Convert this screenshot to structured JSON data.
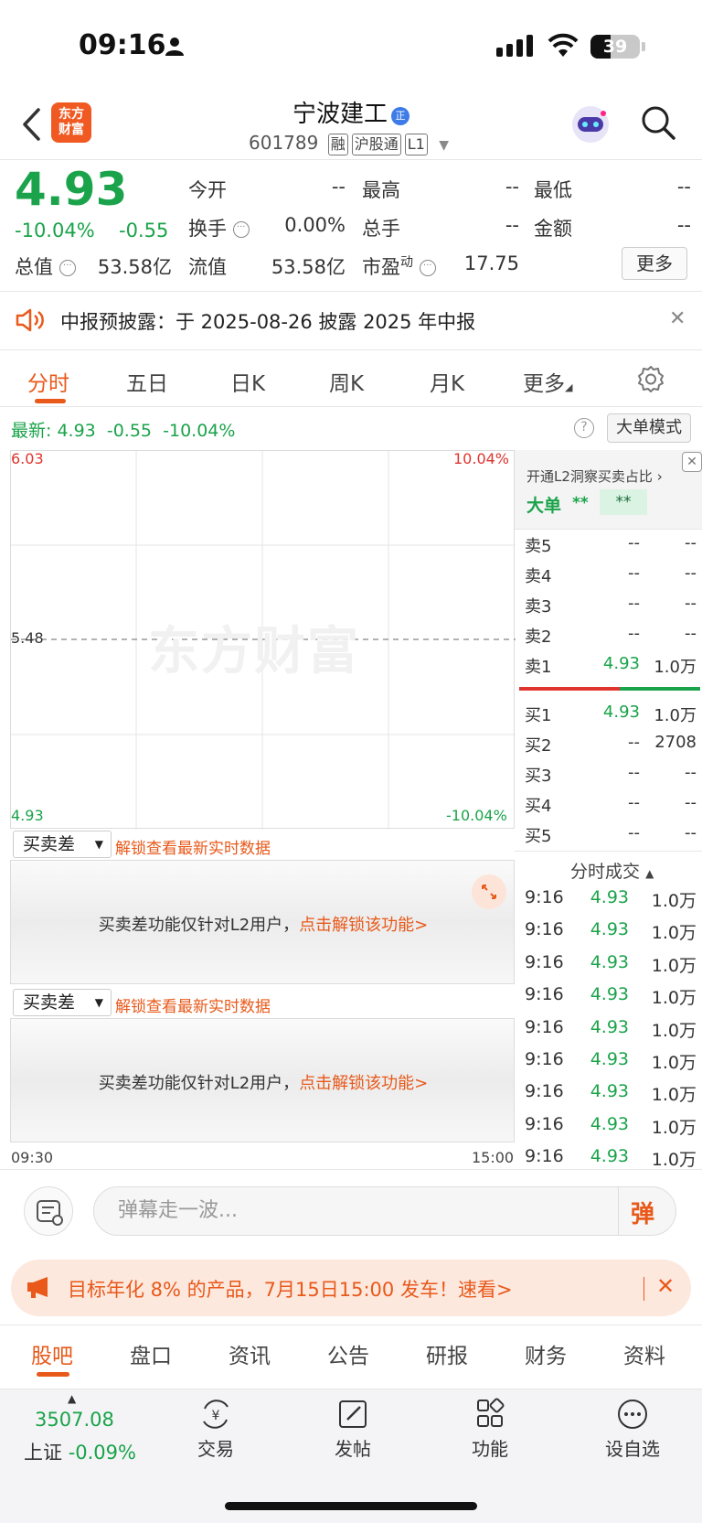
{
  "status": {
    "time": "09:16",
    "battery": "39"
  },
  "header": {
    "logo_line1": "东方",
    "logo_line2": "财富",
    "name": "宁波建工",
    "name_badge": "正",
    "code": "601789",
    "tags": [
      "融",
      "沪股通",
      "L1"
    ]
  },
  "quote": {
    "price": "4.93",
    "pct": "-10.04%",
    "change": "-0.55",
    "fields": [
      {
        "label": "今开",
        "value": "--"
      },
      {
        "label": "最高",
        "value": "--"
      },
      {
        "label": "最低",
        "value": "--"
      },
      {
        "label": "换手",
        "value": "0.00%"
      },
      {
        "label": "总手",
        "value": "--"
      },
      {
        "label": "金额",
        "value": "--"
      },
      {
        "label": "总值",
        "value": "53.58亿"
      },
      {
        "label": "流值",
        "value": "53.58亿"
      },
      {
        "label": "市盈",
        "label_sup": "动",
        "value": "17.75"
      }
    ],
    "more": "更多"
  },
  "notice": {
    "text": "中报预披露：于 2025-08-26 披露 2025 年中报"
  },
  "chart_tabs": [
    "分时",
    "五日",
    "日K",
    "周K",
    "月K",
    "更多"
  ],
  "latest": {
    "label": "最新:",
    "price": "4.93",
    "change": "-0.55",
    "pct": "-10.04%"
  },
  "big_order_mode": "大单模式",
  "chart": {
    "ymax": "6.03",
    "ymid": "5.48",
    "ymin": "4.93",
    "pmax": "10.04%",
    "pmin": "-10.04%",
    "watermark": "东方财富",
    "t_start": "09:30",
    "t_end": "15:00"
  },
  "orderbook": {
    "l2_promo": "开通L2洞察买卖占比",
    "big_label": "大单",
    "big_val1": "**",
    "big_val2": "**",
    "asks": [
      {
        "label": "卖5",
        "price": "--",
        "vol": "--"
      },
      {
        "label": "卖4",
        "price": "--",
        "vol": "--"
      },
      {
        "label": "卖3",
        "price": "--",
        "vol": "--"
      },
      {
        "label": "卖2",
        "price": "--",
        "vol": "--"
      },
      {
        "label": "卖1",
        "price": "4.93",
        "vol": "1.0万"
      }
    ],
    "bids": [
      {
        "label": "买1",
        "price": "4.93",
        "vol": "1.0万"
      },
      {
        "label": "买2",
        "price": "--",
        "vol": "2708"
      },
      {
        "label": "买3",
        "price": "--",
        "vol": "--"
      },
      {
        "label": "买4",
        "price": "--",
        "vol": "--"
      },
      {
        "label": "买5",
        "price": "--",
        "vol": "--"
      }
    ]
  },
  "spread_panels": [
    {
      "select": "买卖差",
      "unlock": "解锁查看最新实时数据",
      "msg": "买卖差功能仅针对L2用户，",
      "link": "点击解锁该功能>"
    },
    {
      "select": "买卖差",
      "unlock": "解锁查看最新实时数据",
      "msg": "买卖差功能仅针对L2用户，",
      "link": "点击解锁该功能>"
    }
  ],
  "trades": {
    "title": "分时成交",
    "rows": [
      {
        "time": "9:16",
        "price": "4.93",
        "vol": "1.0万"
      },
      {
        "time": "9:16",
        "price": "4.93",
        "vol": "1.0万"
      },
      {
        "time": "9:16",
        "price": "4.93",
        "vol": "1.0万"
      },
      {
        "time": "9:16",
        "price": "4.93",
        "vol": "1.0万"
      },
      {
        "time": "9:16",
        "price": "4.93",
        "vol": "1.0万"
      },
      {
        "time": "9:16",
        "price": "4.93",
        "vol": "1.0万"
      },
      {
        "time": "9:16",
        "price": "4.93",
        "vol": "1.0万"
      },
      {
        "time": "9:16",
        "price": "4.93",
        "vol": "1.0万"
      },
      {
        "time": "9:16",
        "price": "4.93",
        "vol": "1.0万"
      }
    ]
  },
  "danmu": {
    "placeholder": "弹幕走一波...",
    "button": "弹"
  },
  "promo": {
    "text": "目标年化 8% 的产品，7月15日15:00 发车！速看>"
  },
  "bottom_tabs": [
    "股吧",
    "盘口",
    "资讯",
    "公告",
    "研报",
    "财务",
    "资料"
  ],
  "nav": {
    "index_value": "3507.08",
    "index_name": "上证",
    "index_pct": "-0.09%",
    "items": [
      "交易",
      "发帖",
      "功能",
      "设自选"
    ]
  },
  "colors": {
    "down": "#1aa34a",
    "up": "#e0342e",
    "accent": "#e8591a"
  }
}
